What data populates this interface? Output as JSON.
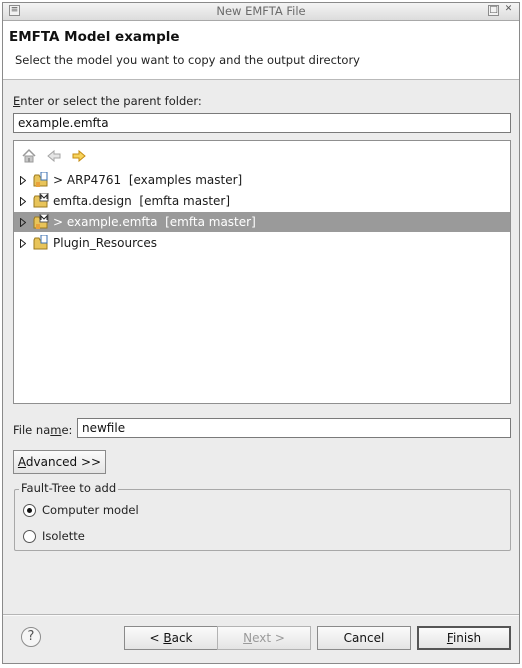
{
  "window": {
    "title": "New EMFTA File",
    "menu_glyph": "≡",
    "max_glyph": "□",
    "close_glyph": "✕"
  },
  "header": {
    "title": "EMFTA Model example",
    "subtitle": "Select the model you want to copy and the output directory"
  },
  "parent_folder": {
    "label_mnemonic": "E",
    "label_rest": "nter or select the parent folder:",
    "value": "example.emfta"
  },
  "tree": {
    "toolbar": {
      "home_icon": "home-icon",
      "back_icon": "back-arrow-icon",
      "forward_icon": "forward-arrow-icon"
    },
    "items": [
      {
        "label": "> ARP4761  [examples master]",
        "icon": "project-folder-icon",
        "selected": false
      },
      {
        "label": "emfta.design  [emfta master]",
        "icon": "modeling-project-icon",
        "selected": false
      },
      {
        "label": "> example.emfta  [emfta master]",
        "icon": "modeling-project-icon",
        "selected": true
      },
      {
        "label": "Plugin_Resources",
        "icon": "project-folder-icon",
        "selected": false
      }
    ]
  },
  "file_name": {
    "label_pre": "File na",
    "label_mnemonic": "m",
    "label_post": "e:",
    "value": "newfile"
  },
  "advanced_button": {
    "mnemonic": "A",
    "rest": "dvanced >>"
  },
  "fault_tree_group": {
    "legend": "Fault-Tree to add",
    "options": [
      {
        "label": "Computer model",
        "checked": true
      },
      {
        "label": "Isolette",
        "checked": false
      }
    ]
  },
  "footer": {
    "help_glyph": "?",
    "back": {
      "pre": "< ",
      "mnemonic": "B",
      "rest": "ack"
    },
    "next": {
      "mnemonic": "N",
      "rest": "ext >"
    },
    "cancel": "Cancel",
    "finish": {
      "mnemonic": "F",
      "rest": "inish"
    }
  },
  "colors": {
    "selection": "#9a9a9a",
    "dialog_bg": "#ececec",
    "header_bg": "#ffffff"
  }
}
